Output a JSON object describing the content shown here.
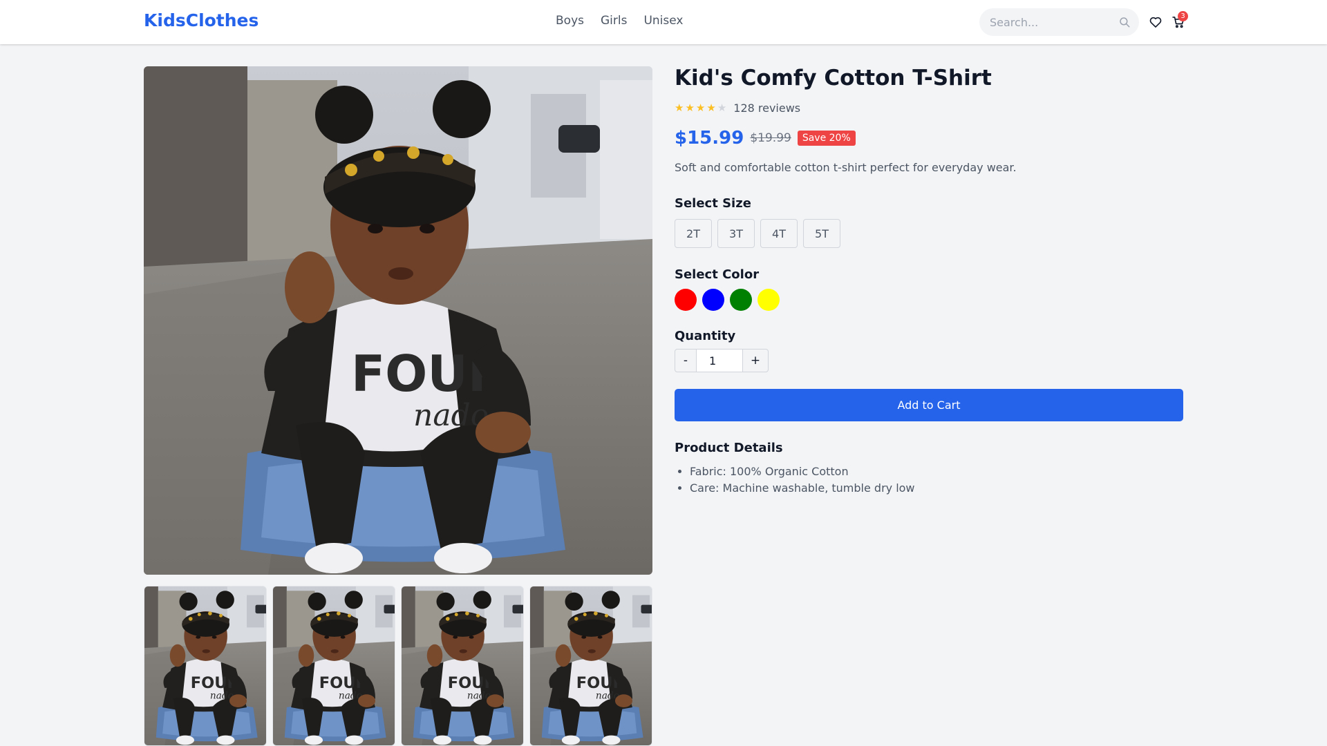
{
  "header": {
    "logo": "KidsClothes",
    "nav": [
      {
        "label": "Boys"
      },
      {
        "label": "Girls"
      },
      {
        "label": "Unisex"
      }
    ],
    "search": {
      "placeholder": "Search..."
    },
    "cart_count": "3",
    "icons": [
      "search-icon",
      "heart-icon",
      "cart-icon"
    ]
  },
  "product": {
    "title": "Kid's Comfy Cotton T-Shirt",
    "rating": 4,
    "rating_max": 5,
    "reviews": "128 reviews",
    "price": "$15.99",
    "old_price": "$19.99",
    "save_badge": "Save 20%",
    "description": "Soft and comfortable cotton t-shirt perfect for everyday wear.",
    "size_title": "Select Size",
    "sizes": [
      {
        "label": "2T"
      },
      {
        "label": "3T"
      },
      {
        "label": "4T"
      },
      {
        "label": "5T"
      }
    ],
    "color_title": "Select Color",
    "colors": [
      "#ff0000",
      "#0000ff",
      "#008000",
      "#ffff00"
    ],
    "quantity_title": "Quantity",
    "quantity": {
      "minus": "-",
      "value": "1",
      "plus": "+"
    },
    "add_to_cart": "Add to Cart",
    "details_title": "Product Details",
    "details": [
      "Fabric: 100% Organic Cotton",
      "Care: Machine washable, tumble dry low"
    ]
  },
  "theme": {
    "accent": "#2563eb",
    "badge": "#ef4444",
    "star_on": "#fbbf24",
    "star_off": "#d1d5db"
  }
}
